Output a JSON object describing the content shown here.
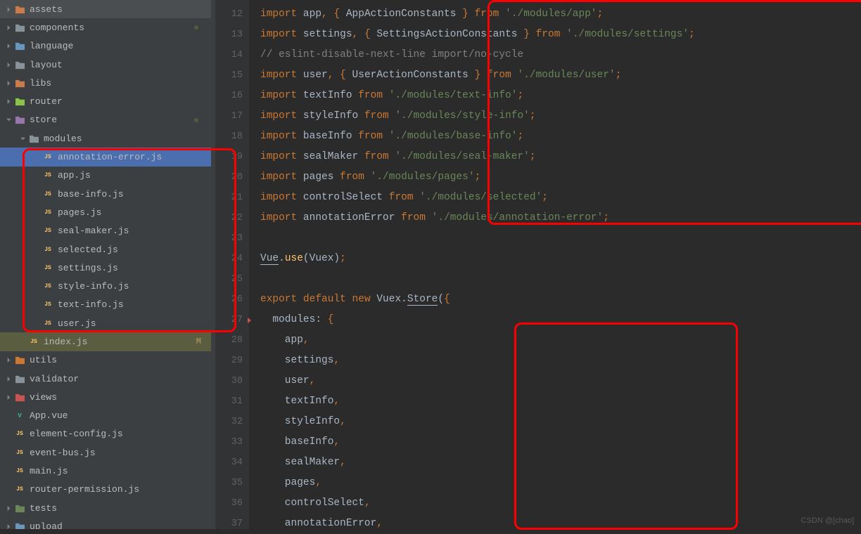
{
  "sidebar": {
    "items": [
      {
        "icon": "folder-asset",
        "label": "assets",
        "indent": 0,
        "chev": "right"
      },
      {
        "icon": "folder",
        "label": "components",
        "indent": 0,
        "chev": "right",
        "dot": true
      },
      {
        "icon": "folder-lang",
        "label": "language",
        "indent": 0,
        "chev": "right"
      },
      {
        "icon": "folder-layout",
        "label": "layout",
        "indent": 0,
        "chev": "right"
      },
      {
        "icon": "folder-libs",
        "label": "libs",
        "indent": 0,
        "chev": "right"
      },
      {
        "icon": "folder-router",
        "label": "router",
        "indent": 0,
        "chev": "right"
      },
      {
        "icon": "folder-store",
        "label": "store",
        "indent": 0,
        "chev": "down",
        "dot": true
      },
      {
        "icon": "folder",
        "label": "modules",
        "indent": 1,
        "chev": "down"
      },
      {
        "icon": "js",
        "label": "annotation-error.js",
        "indent": 2,
        "selected": true
      },
      {
        "icon": "js",
        "label": "app.js",
        "indent": 2
      },
      {
        "icon": "js",
        "label": "base-info.js",
        "indent": 2
      },
      {
        "icon": "js",
        "label": "pages.js",
        "indent": 2
      },
      {
        "icon": "js",
        "label": "seal-maker.js",
        "indent": 2
      },
      {
        "icon": "js",
        "label": "selected.js",
        "indent": 2
      },
      {
        "icon": "js",
        "label": "settings.js",
        "indent": 2
      },
      {
        "icon": "js",
        "label": "style-info.js",
        "indent": 2
      },
      {
        "icon": "js",
        "label": "text-info.js",
        "indent": 2
      },
      {
        "icon": "js",
        "label": "user.js",
        "indent": 2
      },
      {
        "icon": "js",
        "label": "index.js",
        "indent": 1,
        "active": true,
        "badge": "M"
      },
      {
        "icon": "folder-utils",
        "label": "utils",
        "indent": 0,
        "chev": "right"
      },
      {
        "icon": "folder",
        "label": "validator",
        "indent": 0,
        "chev": "right"
      },
      {
        "icon": "folder-views",
        "label": "views",
        "indent": 0,
        "chev": "right"
      },
      {
        "icon": "vue",
        "label": "App.vue",
        "indent": 0
      },
      {
        "icon": "js",
        "label": "element-config.js",
        "indent": 0
      },
      {
        "icon": "js",
        "label": "event-bus.js",
        "indent": 0
      },
      {
        "icon": "js",
        "label": "main.js",
        "indent": 0
      },
      {
        "icon": "js",
        "label": "router-permission.js",
        "indent": 0
      },
      {
        "icon": "folder-tests",
        "label": "tests",
        "indent": -1,
        "chev": "right"
      },
      {
        "icon": "folder-upload",
        "label": "upload",
        "indent": -1,
        "chev": "right"
      }
    ]
  },
  "code": {
    "lines": [
      {
        "n": 12,
        "t": "import",
        "p": [
          [
            "kw-import",
            "import"
          ],
          [
            "white",
            " app"
          ],
          [
            "punct",
            ","
          ],
          [
            "white",
            " "
          ],
          [
            "punct",
            "{"
          ],
          [
            "white",
            " AppActionConstants "
          ],
          [
            "punct",
            "}"
          ],
          [
            "white",
            " "
          ],
          [
            "kw-from",
            "from"
          ],
          [
            "white",
            " "
          ],
          [
            "string",
            "'./modules/app'"
          ],
          [
            "punct",
            ";"
          ]
        ]
      },
      {
        "n": 13,
        "t": "import",
        "p": [
          [
            "kw-import",
            "import"
          ],
          [
            "white",
            " settings"
          ],
          [
            "punct",
            ","
          ],
          [
            "white",
            " "
          ],
          [
            "punct",
            "{"
          ],
          [
            "white",
            " SettingsActionConstants "
          ],
          [
            "punct",
            "}"
          ],
          [
            "white",
            " "
          ],
          [
            "kw-from",
            "from"
          ],
          [
            "white",
            " "
          ],
          [
            "string",
            "'./modules/settings'"
          ],
          [
            "punct",
            ";"
          ]
        ]
      },
      {
        "n": 14,
        "t": "comment",
        "p": [
          [
            "comment",
            "// eslint-disable-next-line import/no-cycle"
          ]
        ]
      },
      {
        "n": 15,
        "t": "import",
        "p": [
          [
            "kw-import",
            "import"
          ],
          [
            "white",
            " user"
          ],
          [
            "punct",
            ","
          ],
          [
            "white",
            " "
          ],
          [
            "punct",
            "{"
          ],
          [
            "white",
            " UserActionConstants "
          ],
          [
            "punct",
            "}"
          ],
          [
            "white",
            " "
          ],
          [
            "kw-from",
            "from"
          ],
          [
            "white",
            " "
          ],
          [
            "string",
            "'./modules/user'"
          ],
          [
            "punct",
            ";"
          ]
        ]
      },
      {
        "n": 16,
        "t": "import",
        "p": [
          [
            "kw-import",
            "import"
          ],
          [
            "white",
            " textInfo "
          ],
          [
            "kw-from",
            "from"
          ],
          [
            "white",
            " "
          ],
          [
            "string",
            "'./modules/text-info'"
          ],
          [
            "punct",
            ";"
          ]
        ]
      },
      {
        "n": 17,
        "t": "import",
        "p": [
          [
            "kw-import",
            "import"
          ],
          [
            "white",
            " styleInfo "
          ],
          [
            "kw-from",
            "from"
          ],
          [
            "white",
            " "
          ],
          [
            "string",
            "'./modules/style-info'"
          ],
          [
            "punct",
            ";"
          ]
        ]
      },
      {
        "n": 18,
        "t": "import",
        "p": [
          [
            "kw-import",
            "import"
          ],
          [
            "white",
            " baseInfo "
          ],
          [
            "kw-from",
            "from"
          ],
          [
            "white",
            " "
          ],
          [
            "string",
            "'./modules/base-info'"
          ],
          [
            "punct",
            ";"
          ]
        ]
      },
      {
        "n": 19,
        "t": "import",
        "p": [
          [
            "kw-import",
            "import"
          ],
          [
            "white",
            " sealMaker "
          ],
          [
            "kw-from",
            "from"
          ],
          [
            "white",
            " "
          ],
          [
            "string",
            "'./modules/seal-maker'"
          ],
          [
            "punct",
            ";"
          ]
        ]
      },
      {
        "n": 20,
        "t": "import",
        "p": [
          [
            "kw-import",
            "import"
          ],
          [
            "white",
            " pages "
          ],
          [
            "kw-from",
            "from"
          ],
          [
            "white",
            " "
          ],
          [
            "string",
            "'./modules/pages'"
          ],
          [
            "punct",
            ";"
          ]
        ]
      },
      {
        "n": 21,
        "t": "import",
        "p": [
          [
            "kw-import",
            "import"
          ],
          [
            "white",
            " controlSelect "
          ],
          [
            "kw-from",
            "from"
          ],
          [
            "white",
            " "
          ],
          [
            "string",
            "'./modules/selected'"
          ],
          [
            "punct",
            ";"
          ]
        ]
      },
      {
        "n": 22,
        "t": "import",
        "p": [
          [
            "kw-import",
            "import"
          ],
          [
            "white",
            " annotationError "
          ],
          [
            "kw-from",
            "from"
          ],
          [
            "white",
            " "
          ],
          [
            "string",
            "'./modules/annotation-error'"
          ],
          [
            "punct",
            ";"
          ]
        ]
      },
      {
        "n": 23,
        "t": "blank",
        "p": []
      },
      {
        "n": 24,
        "t": "stmt",
        "p": [
          [
            "underline",
            "Vue"
          ],
          [
            "white",
            "."
          ],
          [
            "prop",
            "use"
          ],
          [
            "white",
            "(Vuex)"
          ],
          [
            "punct",
            ";"
          ]
        ]
      },
      {
        "n": 25,
        "t": "blank",
        "p": []
      },
      {
        "n": 26,
        "t": "stmt",
        "p": [
          [
            "kw-export",
            "export"
          ],
          [
            "white",
            " "
          ],
          [
            "kw-default",
            "default"
          ],
          [
            "white",
            " "
          ],
          [
            "kw-new",
            "new"
          ],
          [
            "white",
            " Vuex."
          ],
          [
            "underline",
            "Store"
          ],
          [
            "white",
            "("
          ],
          [
            "punct",
            "{"
          ]
        ]
      },
      {
        "n": 27,
        "t": "stmt",
        "bp": true,
        "p": [
          [
            "white",
            "  modules: "
          ],
          [
            "punct",
            "{"
          ]
        ]
      },
      {
        "n": 28,
        "t": "stmt",
        "p": [
          [
            "white",
            "    app"
          ],
          [
            "punct",
            ","
          ]
        ]
      },
      {
        "n": 29,
        "t": "stmt",
        "p": [
          [
            "white",
            "    settings"
          ],
          [
            "punct",
            ","
          ]
        ]
      },
      {
        "n": 30,
        "t": "stmt",
        "p": [
          [
            "white",
            "    user"
          ],
          [
            "punct",
            ","
          ]
        ]
      },
      {
        "n": 31,
        "t": "stmt",
        "p": [
          [
            "white",
            "    textInfo"
          ],
          [
            "punct",
            ","
          ]
        ]
      },
      {
        "n": 32,
        "t": "stmt",
        "p": [
          [
            "white",
            "    styleInfo"
          ],
          [
            "punct",
            ","
          ]
        ]
      },
      {
        "n": 33,
        "t": "stmt",
        "p": [
          [
            "white",
            "    baseInfo"
          ],
          [
            "punct",
            ","
          ]
        ]
      },
      {
        "n": 34,
        "t": "stmt",
        "p": [
          [
            "white",
            "    sealMaker"
          ],
          [
            "punct",
            ","
          ]
        ]
      },
      {
        "n": 35,
        "t": "stmt",
        "p": [
          [
            "white",
            "    pages"
          ],
          [
            "punct",
            ","
          ]
        ]
      },
      {
        "n": 36,
        "t": "stmt",
        "p": [
          [
            "white",
            "    controlSelect"
          ],
          [
            "punct",
            ","
          ]
        ]
      },
      {
        "n": 37,
        "t": "stmt",
        "p": [
          [
            "white",
            "    annotationError"
          ],
          [
            "punct",
            ","
          ]
        ]
      }
    ]
  },
  "watermark": "CSDN @[chao]"
}
